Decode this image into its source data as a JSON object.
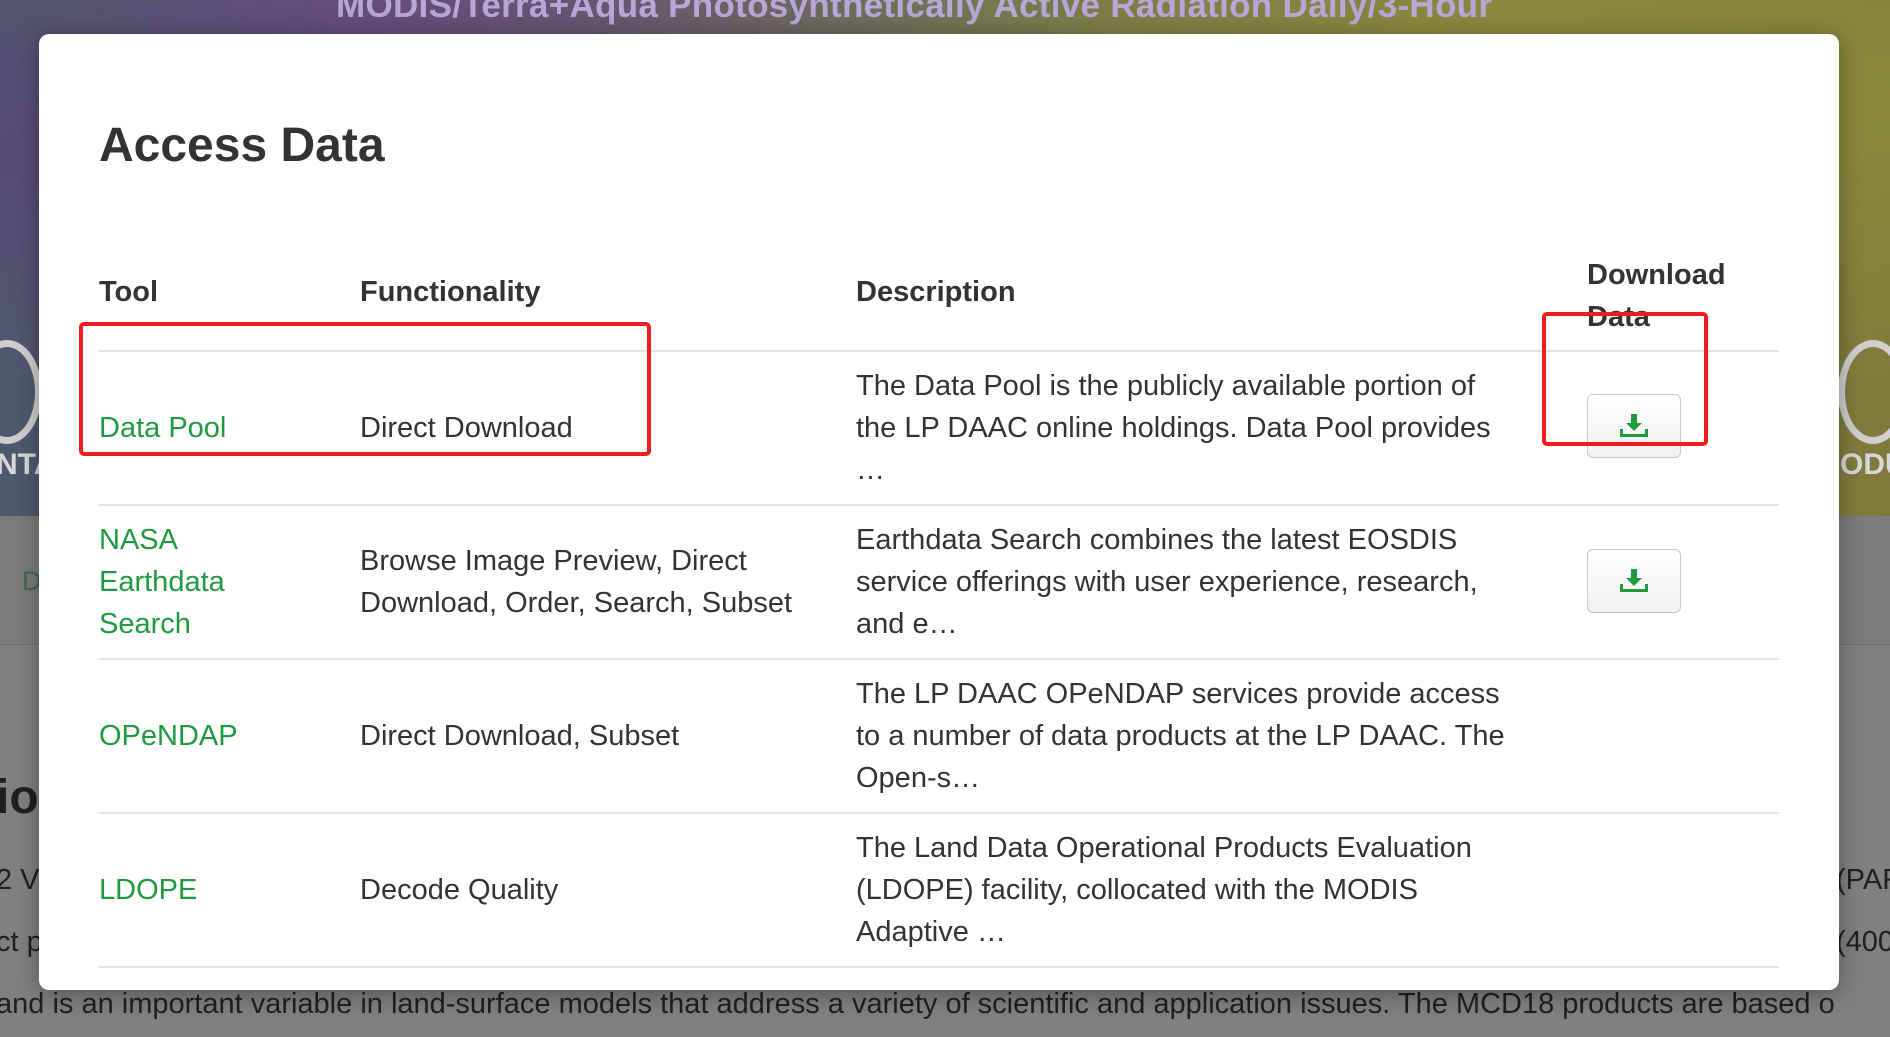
{
  "background": {
    "hero_title": "MODIS/Terra+Aqua Photosynthetically Active Radiation Daily/3-Hour",
    "hero_text_left": "NTA",
    "hero_text_right": "ODU",
    "lower_fragment": "D",
    "heading_fragment": "tio",
    "text_lines": [
      {
        "left": "2 V",
        "right": "(PAR"
      },
      {
        "left": "ct p",
        "right": "(400"
      },
      {
        "full": "and is an important variable in land-surface models that address a variety of scientific and application issues. The MCD18 products are based o"
      }
    ]
  },
  "modal": {
    "title": "Access Data",
    "headers": {
      "tool": "Tool",
      "functionality": "Functionality",
      "description": "Description",
      "download_line1": "Download",
      "download_line2": "Data"
    },
    "rows": [
      {
        "tool_lines": [
          "Data Pool"
        ],
        "functionality_lines": [
          "Direct Download"
        ],
        "description_lines": [
          "The Data Pool is the publicly available portion of",
          "the LP DAAC online holdings. Data Pool provides",
          "…"
        ],
        "has_download": true
      },
      {
        "tool_lines": [
          "NASA",
          "Earthdata",
          "Search"
        ],
        "functionality_lines": [
          "Browse Image Preview, Direct",
          "Download, Order, Search, Subset"
        ],
        "description_lines": [
          "Earthdata Search combines the latest EOSDIS",
          "service offerings with user experience, research,",
          "and e…"
        ],
        "has_download": true
      },
      {
        "tool_lines": [
          "OPeNDAP"
        ],
        "functionality_lines": [
          "Direct Download, Subset"
        ],
        "description_lines": [
          "The LP DAAC OPeNDAP services provide access",
          "to a number of data products at the LP DAAC. The",
          "Open-s…"
        ],
        "has_download": false
      },
      {
        "tool_lines": [
          "LDOPE"
        ],
        "functionality_lines": [
          "Decode Quality"
        ],
        "description_lines": [
          "The Land Data Operational Products Evaluation",
          "(LDOPE) facility, collocated with the MODIS",
          "Adaptive …"
        ],
        "has_download": false
      }
    ],
    "download_icon": "download-icon",
    "accent_color": "#1f9a3f",
    "highlight_color": "#ee1c1c"
  }
}
